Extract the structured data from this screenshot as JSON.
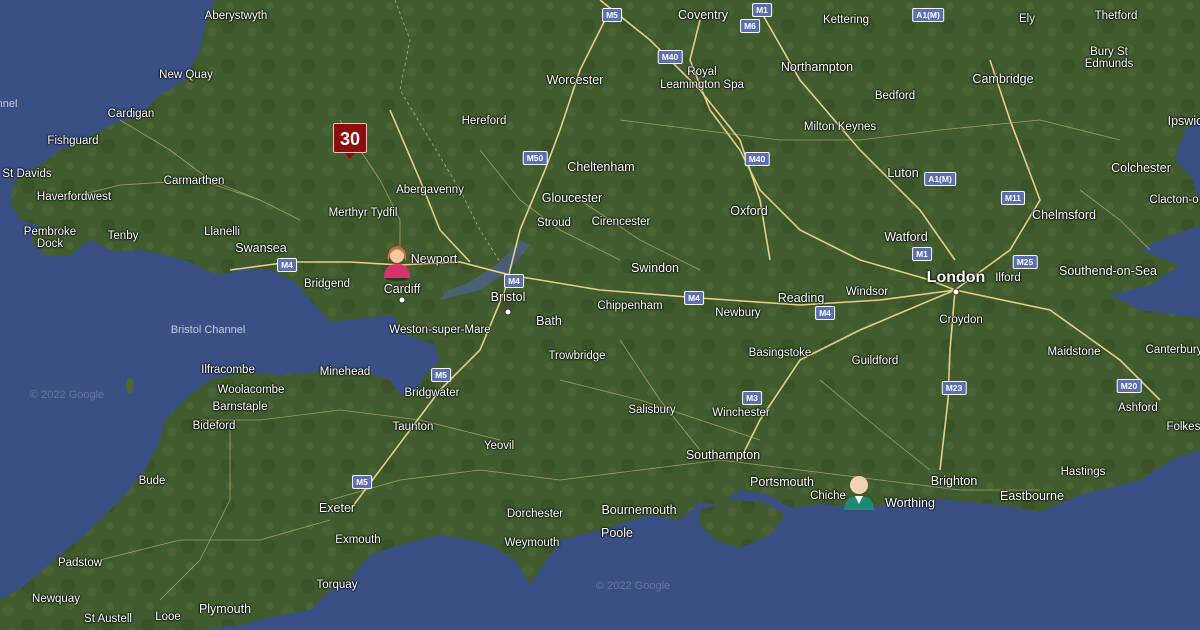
{
  "places": {
    "aberystwyth": "Aberystwyth",
    "new_quay": "New Quay",
    "cardigan": "Cardigan",
    "fishguard": "Fishguard",
    "st_davids": "St Davids",
    "haverfordwest": "Haverfordwest",
    "carmarthen": "Carmarthen",
    "pembroke_dock": "Pembroke\nDock",
    "tenby": "Tenby",
    "llanelli": "Llanelli",
    "swansea": "Swansea",
    "bridgend": "Bridgend",
    "cardiff": "Cardiff",
    "newport": "Newport",
    "merthyr_tydfil": "Merthyr Tydfil",
    "abergavenny": "Abergavenny",
    "hereford": "Hereford",
    "worcester": "Worcester",
    "coventry": "Coventry",
    "royal_leamington_spa": "Royal\nLeamington Spa",
    "kettering": "Kettering",
    "northampton": "Northampton",
    "ely": "Ely",
    "thetford": "Thetford",
    "bury_st_edmunds": "Bury St\nEdmunds",
    "cambridge": "Cambridge",
    "bedford": "Bedford",
    "milton_keynes": "Milton Keynes",
    "ipswich": "Ipswic",
    "cheltenham": "Cheltenham",
    "gloucester": "Gloucester",
    "stroud": "Stroud",
    "cirencester": "Cirencester",
    "oxford": "Oxford",
    "luton": "Luton",
    "colchester": "Colchester",
    "clacton": "Clacton-o",
    "chelmsford": "Chelmsford",
    "watford": "Watford",
    "london": "London",
    "ilford": "Ilford",
    "southend": "Southend-on-Sea",
    "swindon": "Swindon",
    "bristol": "Bristol",
    "chippenham": "Chippenham",
    "newbury": "Newbury",
    "reading": "Reading",
    "windsor": "Windsor",
    "croydon": "Croydon",
    "weston": "Weston-super-Mare",
    "bath": "Bath",
    "trowbridge": "Trowbridge",
    "basingstoke": "Basingstoke",
    "guildford": "Guildford",
    "maidstone": "Maidstone",
    "canterbury": "Canterbury",
    "ilfracombe": "Ilfracombe",
    "woolacombe": "Woolacombe",
    "minehead": "Minehead",
    "barnstaple": "Barnstaple",
    "bridgwater": "Bridgwater",
    "bideford": "Bideford",
    "taunton": "Taunton",
    "salisbury": "Salisbury",
    "winchester": "Winchester",
    "ashford": "Ashford",
    "folkestone": "Folkest",
    "yeovil": "Yeovil",
    "southampton": "Southampton",
    "hastings": "Hastings",
    "bude": "Bude",
    "portsmouth": "Portsmouth",
    "chichester": "Chiche",
    "worthing": "Worthing",
    "brighton": "Brighton",
    "eastbourne": "Eastbourne",
    "exeter": "Exeter",
    "dorchester": "Dorchester",
    "bournemouth": "Bournemouth",
    "poole": "Poole",
    "exmouth": "Exmouth",
    "weymouth": "Weymouth",
    "torquay": "Torquay",
    "padstow": "Padstow",
    "newquay": "Newquay",
    "plymouth": "Plymouth",
    "st_austell": "St Austell",
    "looe": "Looe",
    "nnel": "nnel"
  },
  "sea_labels": {
    "bristol_channel": "Bristol Channel"
  },
  "roads": [
    "M5",
    "M1",
    "M6",
    "A1(M)",
    "M40",
    "M50",
    "M40",
    "A1(M)",
    "M11",
    "M1",
    "M25",
    "M4",
    "M4",
    "M4",
    "M4",
    "M5",
    "M3",
    "M23",
    "M20",
    "M5"
  ],
  "watermarks": [
    "© 2022 Google",
    "© 2022 Google"
  ],
  "cluster_marker": {
    "count": "30"
  },
  "person_markers": [
    "female-user-marker",
    "male-user-marker"
  ],
  "colors": {
    "sea": "#3a4f84",
    "land": "#3f5a2f",
    "cluster": "#8e0d0d",
    "road_shield": "#5b6fb0"
  }
}
